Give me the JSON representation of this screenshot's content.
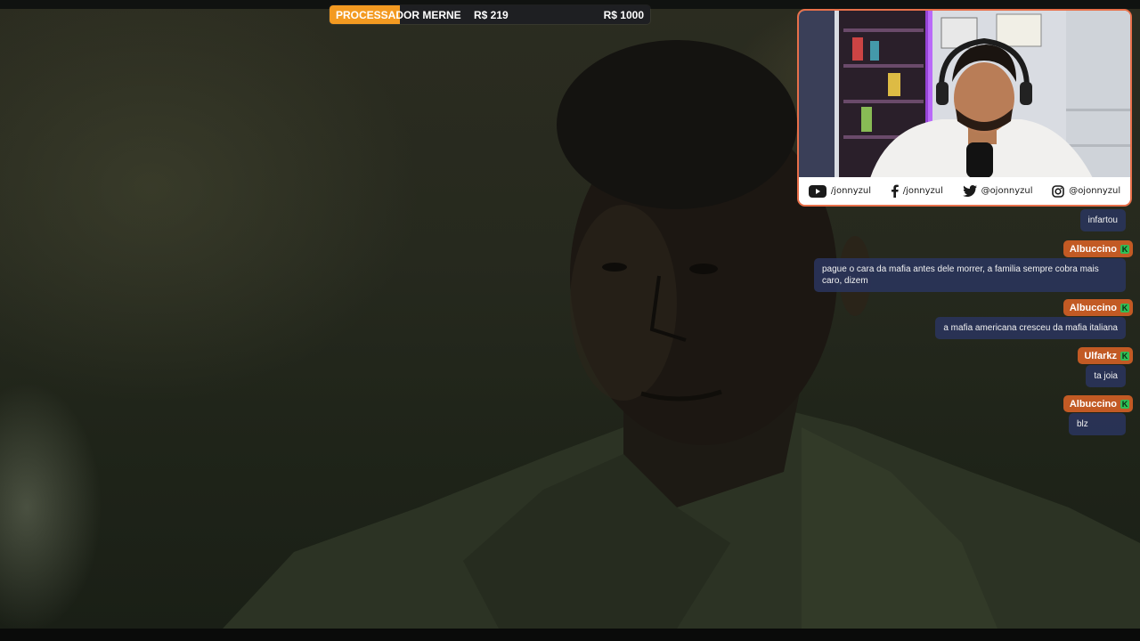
{
  "goal": {
    "title": "PROCESSADOR MERNE",
    "current": "R$ 219",
    "target": "R$ 1000",
    "progress": 0.219,
    "fill_color": "#f39a21"
  },
  "webcam": {
    "border_color": "#e8704a",
    "socials": [
      {
        "icon": "youtube-icon",
        "handle": "/jonnyzul"
      },
      {
        "icon": "facebook-icon",
        "handle": "/jonnyzul"
      },
      {
        "icon": "twitter-icon",
        "handle": "@ojonnyzul"
      },
      {
        "icon": "instagram-icon",
        "handle": "@ojonnyzul"
      }
    ]
  },
  "chat": {
    "name_tag_color": "#c25a24",
    "bubble_color": "#2a345c",
    "messages": [
      {
        "user": "",
        "text": "infartou"
      },
      {
        "user": "Albuccino",
        "text": "pague o cara da mafia antes dele morrer, a familia sempre cobra mais caro, dizem"
      },
      {
        "user": "Albuccino",
        "text": "a mafia americana cresceu da mafia italiana"
      },
      {
        "user": "Ulfarkz",
        "text": "ta joia"
      },
      {
        "user": "Albuccino",
        "text": "blz"
      }
    ]
  }
}
